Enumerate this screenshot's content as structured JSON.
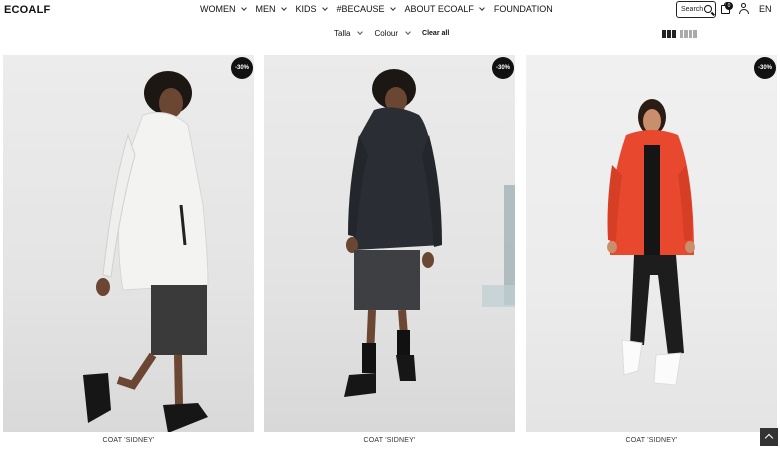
{
  "header": {
    "logo": "ECOALF",
    "nav": [
      {
        "label": "WOMEN"
      },
      {
        "label": "MEN"
      },
      {
        "label": "KIDS"
      },
      {
        "label": "#BECAUSE"
      },
      {
        "label": "ABOUT ECOALF"
      },
      {
        "label": "FOUNDATION"
      }
    ],
    "search_label": "Search",
    "bag_count": "0",
    "language": "EN"
  },
  "filters": {
    "size": "Talla",
    "colour": "Colour",
    "clear": "Clear all"
  },
  "products": [
    {
      "name": "COAT 'SIDNEY'",
      "discount": "-30%",
      "color": "#f4f4f2"
    },
    {
      "name": "COAT 'SIDNEY'",
      "discount": "-30%",
      "color": "#2a2d33"
    },
    {
      "name": "COAT 'SIDNEY'",
      "discount": "-30%",
      "color": "#e8492e"
    }
  ]
}
